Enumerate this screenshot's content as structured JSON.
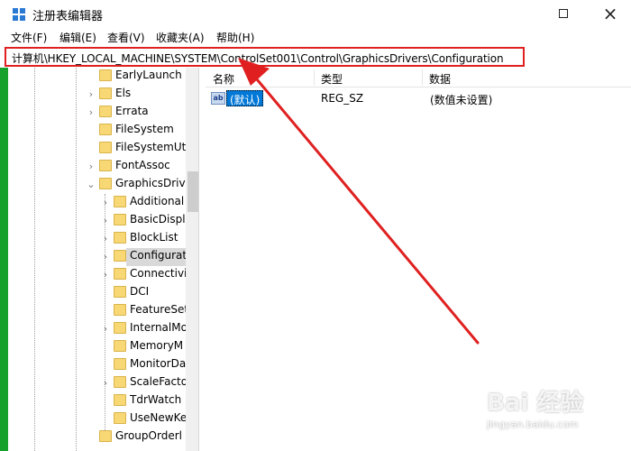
{
  "window": {
    "title": "注册表编辑器",
    "close_glyph": "×"
  },
  "menu": {
    "items": [
      "文件(F)",
      "编辑(E)",
      "查看(V)",
      "收藏夹(A)",
      "帮助(H)"
    ]
  },
  "address": {
    "path": "计算机\\HKEY_LOCAL_MACHINE\\SYSTEM\\ControlSet001\\Control\\GraphicsDrivers\\Configuration"
  },
  "tree": {
    "items": [
      {
        "label": "EarlyLaunch",
        "chevron": ""
      },
      {
        "label": "Els",
        "chevron": "›"
      },
      {
        "label": "Errata",
        "chevron": "›"
      },
      {
        "label": "FileSystem",
        "chevron": ""
      },
      {
        "label": "FileSystemUti",
        "chevron": ""
      },
      {
        "label": "FontAssoc",
        "chevron": "›"
      },
      {
        "label": "GraphicsDriv",
        "chevron": "⌄"
      },
      {
        "label": "Additional",
        "chevron": "›"
      },
      {
        "label": "BasicDispl",
        "chevron": "›"
      },
      {
        "label": "BlockList",
        "chevron": "›"
      },
      {
        "label": "Configurat",
        "chevron": "›"
      },
      {
        "label": "Connectivi",
        "chevron": "›"
      },
      {
        "label": "DCI",
        "chevron": ""
      },
      {
        "label": "FeatureSet",
        "chevron": ""
      },
      {
        "label": "InternalMo",
        "chevron": "›"
      },
      {
        "label": "MemoryM",
        "chevron": ""
      },
      {
        "label": "MonitorDa",
        "chevron": ""
      },
      {
        "label": "ScaleFacto",
        "chevron": "›"
      },
      {
        "label": "TdrWatch",
        "chevron": ""
      },
      {
        "label": "UseNewKe",
        "chevron": ""
      },
      {
        "label": "GroupOrderl",
        "chevron": ""
      }
    ]
  },
  "list": {
    "columns": [
      "名称",
      "类型",
      "数据"
    ],
    "rows": [
      {
        "icon": "ab",
        "name": "(默认)",
        "type": "REG_SZ",
        "data": "(数值未设置)"
      }
    ]
  },
  "watermark": {
    "logo": "Bai 经验",
    "url": "jingyan.baidu.com"
  },
  "colors": {
    "highlight_border": "#e02020",
    "selection": "#0078d7",
    "folder": "#f8d775",
    "left_strip": "#16a02c"
  }
}
